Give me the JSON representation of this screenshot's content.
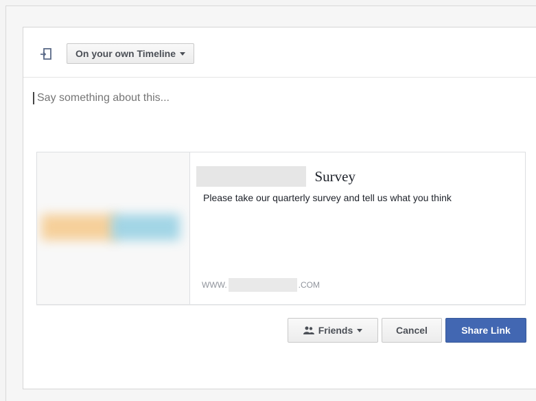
{
  "header": {
    "icon": "share-icon",
    "audience_label": "On your own Timeline"
  },
  "compose": {
    "placeholder": "Say something about this..."
  },
  "link_preview": {
    "title": "Survey",
    "description": "Please take our quarterly survey and tell us what you think",
    "domain_prefix": "WWW.",
    "domain_suffix": ".COM"
  },
  "actions": {
    "privacy_label": "Friends",
    "privacy_icon": "friends-icon",
    "cancel_label": "Cancel",
    "share_label": "Share Link"
  },
  "colors": {
    "primary": "#4267b2",
    "text": "#4b4f56",
    "placeholder": "#9197a3"
  }
}
